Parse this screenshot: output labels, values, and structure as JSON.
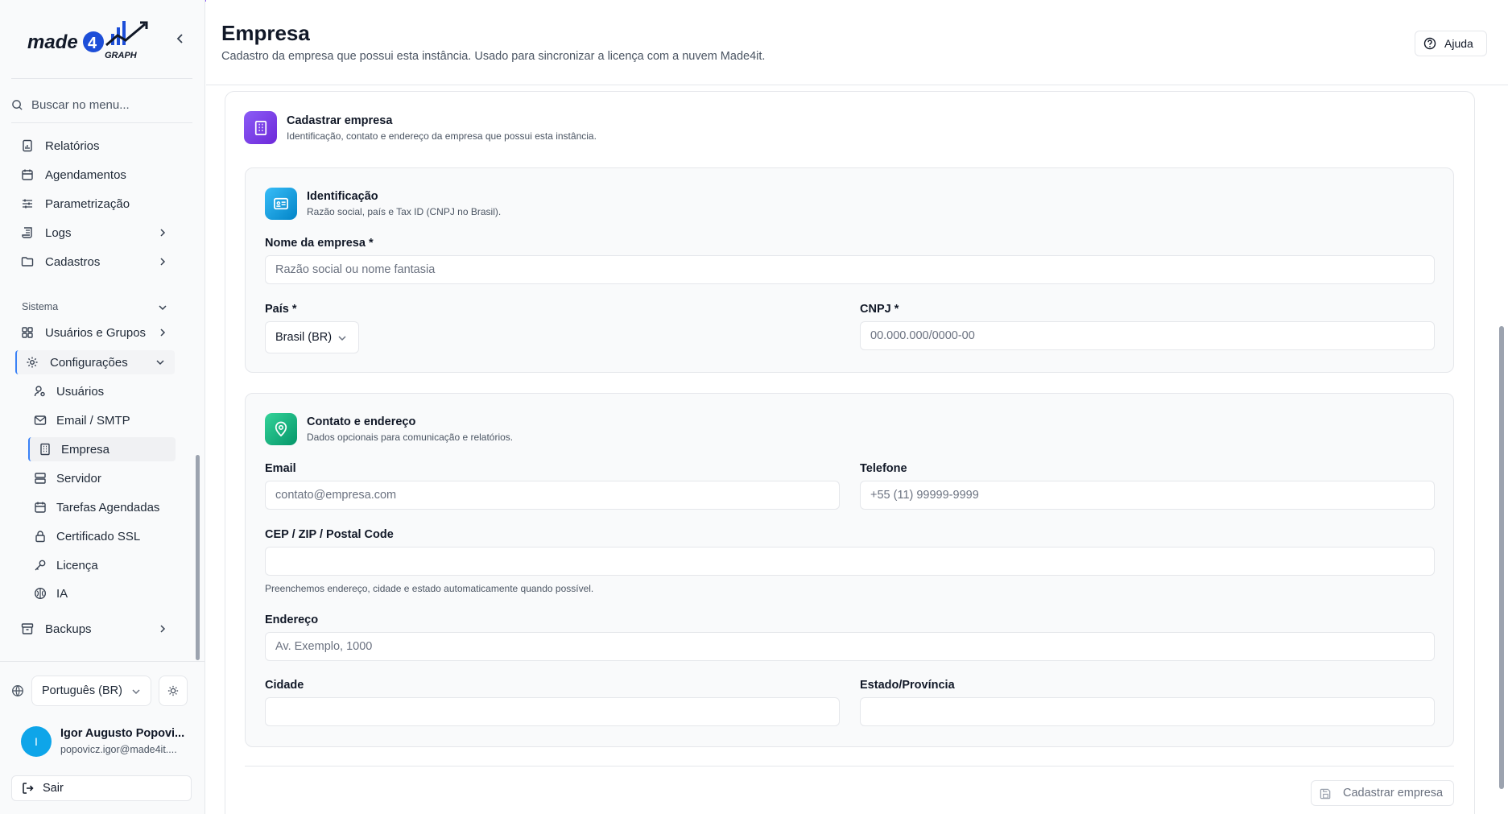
{
  "colors": {
    "accent": "#3b82f6",
    "brand_purple": "#8b5cf6",
    "identity_blue": "#0ea5e9",
    "contact_green": "#10b981"
  },
  "sidebar": {
    "logo_text": "made4GRAPH",
    "search_placeholder": "Buscar no menu...",
    "items": [
      {
        "label": "Relatórios",
        "icon": "report-icon"
      },
      {
        "label": "Agendamentos",
        "icon": "calendar-icon"
      },
      {
        "label": "Parametrização",
        "icon": "sliders-icon"
      },
      {
        "label": "Logs",
        "icon": "scroll-icon"
      },
      {
        "label": "Cadastros",
        "icon": "folder-icon"
      }
    ],
    "section_label": "Sistema",
    "system_items": [
      {
        "label": "Usuários e Grupos",
        "icon": "grid-icon"
      },
      {
        "label": "Configurações",
        "icon": "gear-icon"
      }
    ],
    "config_items": [
      {
        "label": "Usuários",
        "icon": "users-icon"
      },
      {
        "label": "Email / SMTP",
        "icon": "mail-icon"
      },
      {
        "label": "Empresa",
        "icon": "building-icon"
      },
      {
        "label": "Servidor",
        "icon": "server-icon"
      },
      {
        "label": "Tarefas Agendadas",
        "icon": "calendar-icon"
      },
      {
        "label": "Certificado SSL",
        "icon": "lock-icon"
      },
      {
        "label": "Licença",
        "icon": "key-icon"
      },
      {
        "label": "IA",
        "icon": "brain-icon"
      }
    ],
    "backups_label": "Backups",
    "language": "Português (BR)",
    "user": {
      "initial": "I",
      "name": "Igor Augusto Popovi...",
      "email": "popovicz.igor@made4it...."
    },
    "logout_label": "Sair"
  },
  "header": {
    "title": "Empresa",
    "subtitle": "Cadastro da empresa que possui esta instância. Usado para sincronizar a licença com a nuvem Made4it.",
    "help_label": "Ajuda"
  },
  "card": {
    "title": "Cadastrar empresa",
    "subtitle": "Identificação, contato e endereço da empresa que possui esta instância."
  },
  "identification": {
    "title": "Identificação",
    "subtitle": "Razão social, país e Tax ID (CNPJ no Brasil).",
    "company_label": "Nome da empresa *",
    "company_placeholder": "Razão social ou nome fantasia",
    "country_label": "País *",
    "country_value": "Brasil (BR)",
    "cnpj_label": "CNPJ *",
    "cnpj_placeholder": "00.000.000/0000-00"
  },
  "contact": {
    "title": "Contato e endereço",
    "subtitle": "Dados opcionais para comunicação e relatórios.",
    "email_label": "Email",
    "email_placeholder": "contato@empresa.com",
    "phone_label": "Telefone",
    "phone_placeholder": "+55 (11) 99999-9999",
    "cep_label": "CEP / ZIP / Postal Code",
    "cep_hint": "Preenchemos endereço, cidade e estado automaticamente quando possível.",
    "address_label": "Endereço",
    "address_placeholder": "Av. Exemplo, 1000",
    "city_label": "Cidade",
    "state_label": "Estado/Província"
  },
  "submit_label": "Cadastrar empresa"
}
